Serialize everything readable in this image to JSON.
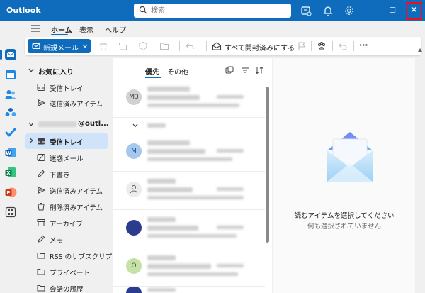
{
  "window": {
    "title": "Outlook",
    "close_symbol": "✕",
    "minimize_symbol": "—",
    "maximize_symbol": "☐"
  },
  "search": {
    "placeholder": "検索"
  },
  "ribbon": {
    "tabs": [
      {
        "label": "ホーム",
        "active": true
      },
      {
        "label": "表示"
      },
      {
        "label": "ヘルプ"
      }
    ],
    "new_mail_label": "新規メール",
    "mark_all_read_label": "すべて開封済みにする",
    "more_symbol": "···"
  },
  "folders": {
    "favorites_label": "お気に入り",
    "favorites": [
      {
        "label": "受信トレイ"
      },
      {
        "label": "送信済みアイテム"
      }
    ],
    "account_domain": "@outl...",
    "items": [
      {
        "label": "受信トレイ",
        "selected": true
      },
      {
        "label": "迷惑メール"
      },
      {
        "label": "下書き"
      },
      {
        "label": "送信済みアイテム"
      },
      {
        "label": "削除済みアイテム"
      },
      {
        "label": "アーカイブ"
      },
      {
        "label": "メモ"
      },
      {
        "label": "RSS のサブスクリプ..."
      },
      {
        "label": "プライベート"
      },
      {
        "label": "会話の履歴"
      }
    ]
  },
  "message_list": {
    "tabs": [
      {
        "label": "優先",
        "active": true
      },
      {
        "label": "その他"
      }
    ],
    "messages": [
      {
        "avatar": "M3",
        "avatar_bg": "#d1d1d1",
        "avatar_fg": "#424242"
      },
      {
        "avatar": "M",
        "avatar_bg": "#a6c8ee",
        "avatar_fg": "#0f548c"
      },
      {
        "avatar": "",
        "avatar_bg": "#ececec",
        "avatar_fg": "#616161"
      },
      {
        "avatar": "",
        "avatar_bg": "#2b3c8f",
        "avatar_fg": "#ffffff"
      },
      {
        "avatar": "O",
        "avatar_bg": "#c5e1a5",
        "avatar_fg": "#33691e"
      },
      {
        "avatar": "",
        "avatar_bg": "#2b3c8f",
        "avatar_fg": "#ffffff"
      }
    ]
  },
  "reading_pane": {
    "title": "読むアイテムを選択してください",
    "subtitle": "何も選択されていません"
  },
  "colors": {
    "brand": "#0f6cbd",
    "close_highlight": "#e81123",
    "selected_folder": "#cfe4fa"
  }
}
